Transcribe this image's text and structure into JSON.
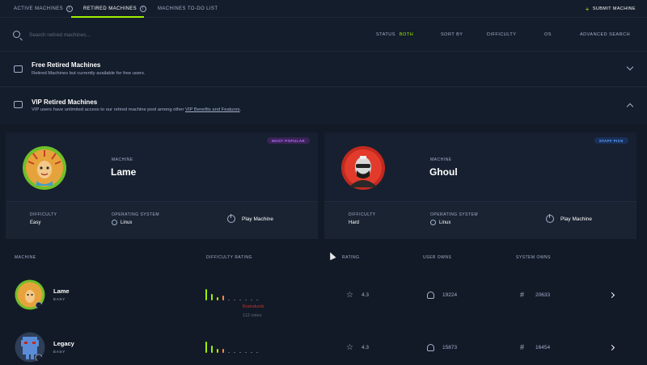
{
  "tabs": [
    {
      "label": "Active Machines"
    },
    {
      "label": "Retired Machines"
    },
    {
      "label": "Machines To-Do List"
    }
  ],
  "submit_label": "Submit Machine",
  "search": {
    "placeholder": "Search retired machines..."
  },
  "filters": {
    "status_label": "Status",
    "status_value": "Both",
    "sort_label": "Sort By",
    "difficulty_label": "Difficulty",
    "os_label": "OS",
    "advanced_label": "Advanced Search"
  },
  "free_section": {
    "title": "Free Retired Machines",
    "subtitle": "Retired Machines but currently available for free users."
  },
  "vip_section": {
    "title": "VIP Retired Machines",
    "subtitle_pre": "VIP users have unlimited access to our retired machine pool among other ",
    "link": "VIP Benefits and Features",
    "subtitle_post": "."
  },
  "cards": [
    {
      "badge": "Most Popular",
      "machine_label": "Machine",
      "name": "Lame",
      "difficulty_label": "Difficulty",
      "difficulty": "Easy",
      "os_label": "Operating System",
      "os": "Linux",
      "play": "Play Machine"
    },
    {
      "badge": "Staff Pick",
      "machine_label": "Machine",
      "name": "Ghoul",
      "difficulty_label": "Difficulty",
      "difficulty": "Hard",
      "os_label": "Operating System",
      "os": "Linux",
      "play": "Play Machine"
    }
  ],
  "table": {
    "headers": {
      "machine": "Machine",
      "difficulty": "Difficulty Rating",
      "rating": "Rating",
      "user_owns": "User Owns",
      "system_owns": "System Owns"
    },
    "rows": [
      {
        "name": "Lame",
        "difficulty": "Easy",
        "rating": "4.3",
        "user_owns": "19224",
        "system_owns": "20633"
      },
      {
        "name": "Legacy",
        "difficulty": "Easy",
        "rating": "4.3",
        "user_owns": "15873",
        "system_owns": "16454"
      }
    ],
    "tooltip": {
      "label": "Braindumb",
      "votes": "112 votes"
    }
  },
  "colors": {
    "accent": "#9fef00",
    "background": "#121a27",
    "panel": "#141d2b"
  }
}
